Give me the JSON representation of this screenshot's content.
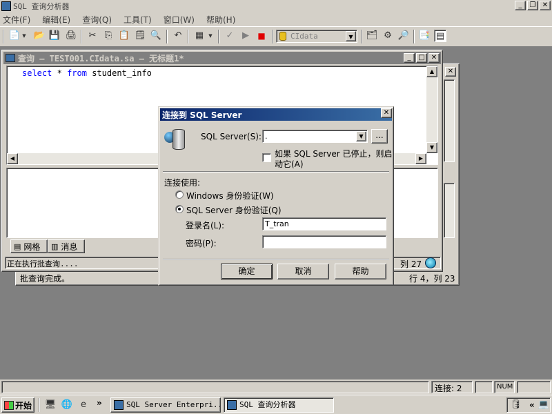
{
  "app": {
    "title": "SQL 查询分析器"
  },
  "menu": [
    "文件(F)",
    "编辑(E)",
    "查询(Q)",
    "工具(T)",
    "窗口(W)",
    "帮助(H)"
  ],
  "toolbar": {
    "database": "CIdata"
  },
  "query_window": {
    "title": "查询 — TEST001.CIdata.sa — 无标题1*",
    "code": {
      "kw1": "select",
      "op": "*",
      "kw2": "from",
      "table": "student_info"
    },
    "tabs": {
      "grid": "网格",
      "messages": "消息"
    },
    "status": "正在执行批查询....",
    "pos": "列 27"
  },
  "back_window": {
    "status": "批查询完成。",
    "pos": "行 4，列 23"
  },
  "dialog": {
    "title": "连接到 SQL Server",
    "server_label": "SQL Server(S):",
    "server_value": ".",
    "browse": "...",
    "autostart_line1": "如果 SQL Server 已停止，则启",
    "autostart_line2": "动它(A)",
    "connect_using": "连接使用:",
    "windows_auth": "Windows 身份验证(W)",
    "sql_auth": "SQL Server 身份验证(Q)",
    "login_label": "登录名(L):",
    "login_value": "T_tran",
    "password_label": "密码(P):",
    "password_value": "",
    "ok": "确定",
    "cancel": "取消",
    "help": "帮助"
  },
  "statusbar": {
    "connections": "连接: 2",
    "num": "NUM"
  },
  "taskbar": {
    "start": "开始",
    "more": "»",
    "items": [
      "SQL Server Enterpri...",
      "SQL 查询分析器"
    ],
    "tray_more": "«"
  }
}
